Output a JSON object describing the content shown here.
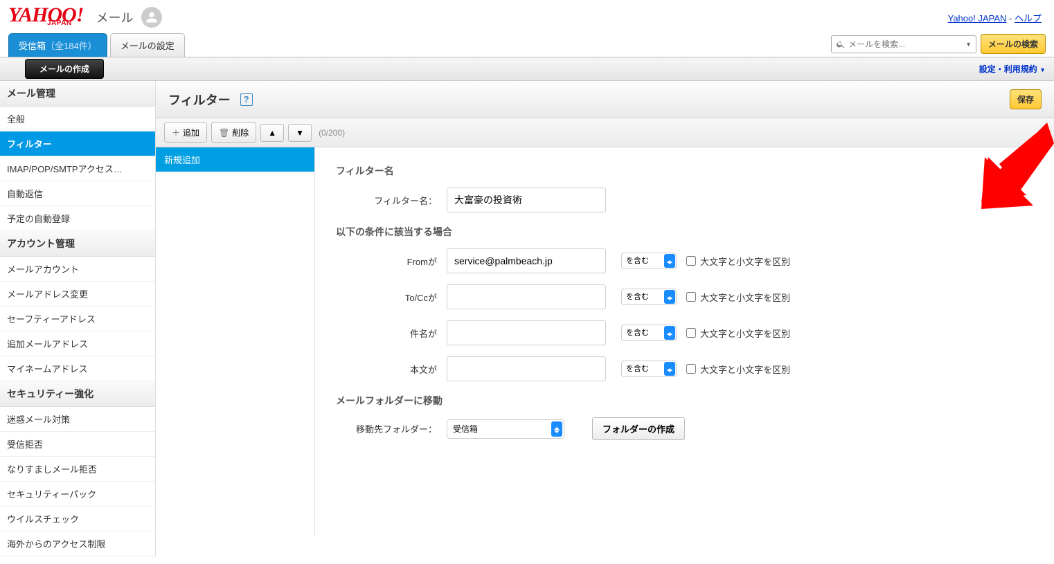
{
  "header": {
    "logo_main": "YAHOO!",
    "logo_sub": "JAPAN",
    "logo_mail": "メール",
    "link_yahoo": "Yahoo! JAPAN",
    "link_help": "ヘルプ"
  },
  "tabs": {
    "inbox": "受信箱",
    "inbox_count": "（全184件）",
    "settings": "メールの設定"
  },
  "search": {
    "placeholder": "メールを検索...",
    "button": "メールの検索"
  },
  "toolbar": {
    "compose": "メールの作成",
    "settings_link": "設定・利用規約"
  },
  "sidebar": {
    "section1": "メール管理",
    "items1": [
      "全般",
      "フィルター",
      "IMAP/POP/SMTPアクセス…",
      "自動返信",
      "予定の自動登録"
    ],
    "section2": "アカウント管理",
    "items2": [
      "メールアカウント",
      "メールアドレス変更",
      "セーフティーアドレス",
      "追加メールアドレス",
      "マイネームアドレス"
    ],
    "section3": "セキュリティー強化",
    "items3": [
      "迷惑メール対策",
      "受信拒否",
      "なりすましメール拒否",
      "セキュリティーパック",
      "ウイルスチェック",
      "海外からのアクセス制限"
    ]
  },
  "panel": {
    "title": "フィルター",
    "save": "保存",
    "add": "追加",
    "delete": "削除",
    "counter": "(0/200)"
  },
  "filter_list": {
    "item1": "新規追加"
  },
  "form": {
    "sec_name": "フィルター名",
    "label_name": "フィルター名：",
    "val_name": "大富豪の投資術",
    "sec_cond": "以下の条件に該当する場合",
    "label_from": "Fromが",
    "val_from": "service@palmbeach.jp",
    "label_tocc": "To/Ccが",
    "val_tocc": "",
    "label_subject": "件名が",
    "val_subject": "",
    "label_body": "本文が",
    "val_body": "",
    "opt_contains": "を含む",
    "chk_case": "大文字と小文字を区別",
    "sec_move": "メールフォルダーに移動",
    "label_folder": "移動先フォルダー：",
    "opt_folder": "受信箱",
    "btn_create_folder": "フォルダーの作成"
  }
}
